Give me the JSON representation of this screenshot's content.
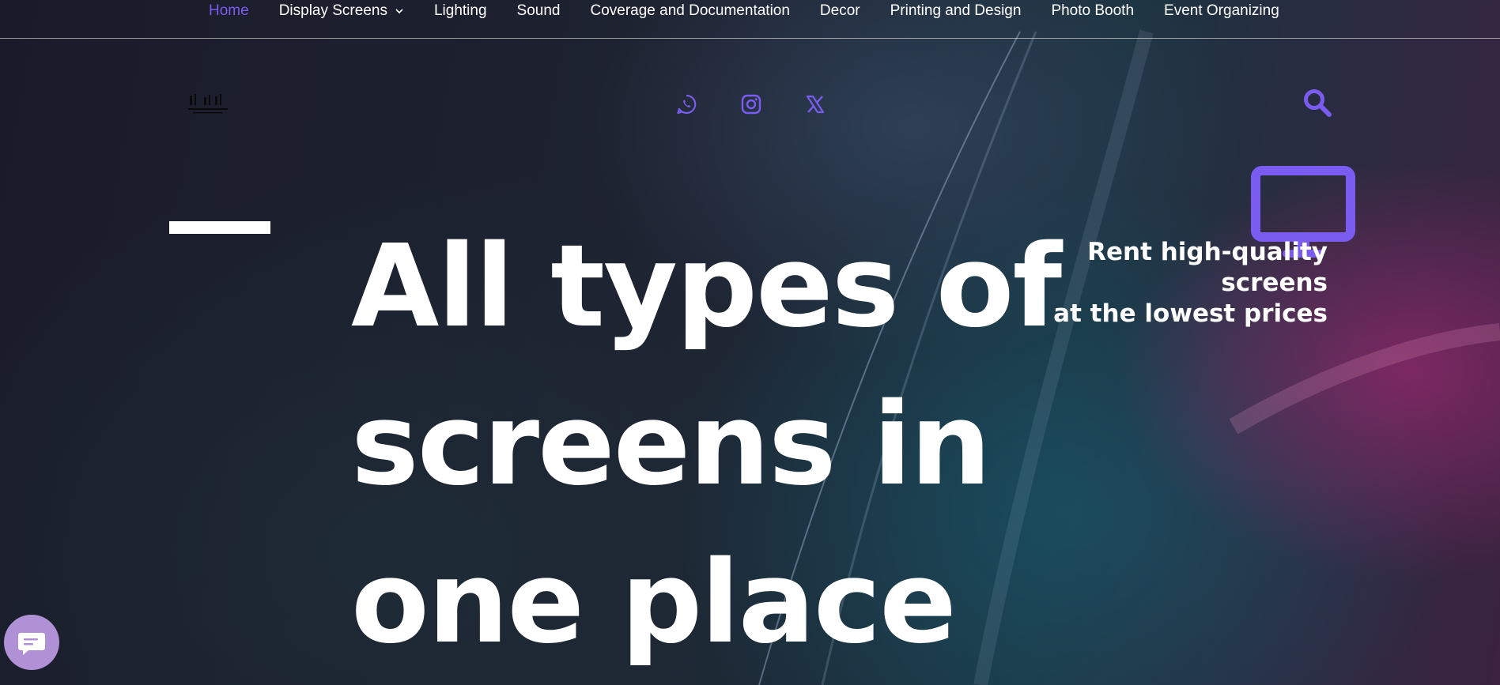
{
  "nav": {
    "items": [
      {
        "label": "Home",
        "active": true
      },
      {
        "label": "Display Screens",
        "dropdown": true
      },
      {
        "label": "Lighting"
      },
      {
        "label": "Sound"
      },
      {
        "label": "Coverage and Documentation"
      },
      {
        "label": "Decor"
      },
      {
        "label": "Printing and Design"
      },
      {
        "label": "Photo Booth"
      },
      {
        "label": "Event Organizing"
      }
    ]
  },
  "header": {
    "social_icons": [
      "whatsapp-icon",
      "instagram-icon",
      "x-twitter-icon"
    ],
    "search_icon": "search-icon"
  },
  "hero": {
    "headline": "All types of screens in one place",
    "tagline_line1": "Rent high-quality screens",
    "tagline_line2": "at the lowest prices",
    "feature_icon": "monitor-icon"
  },
  "colors": {
    "accent": "#7b5cf0",
    "chat_button": "#b091d6"
  },
  "widgets": {
    "chat_icon": "chat-icon"
  }
}
